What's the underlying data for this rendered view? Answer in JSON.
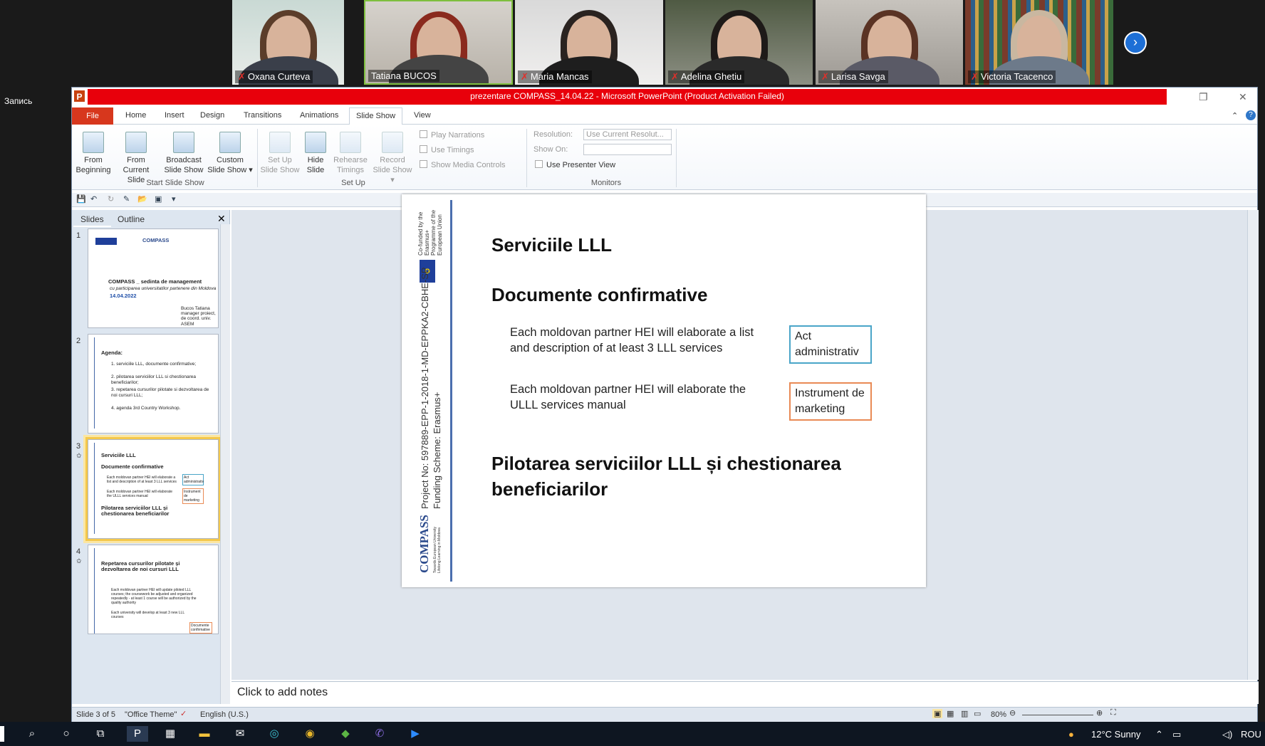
{
  "zoom": {
    "participants": [
      {
        "name": "Oxana Curteva"
      },
      {
        "name": "Tatiana BUCOS"
      },
      {
        "name": "Maria Mancas"
      },
      {
        "name": "Adelina Ghetiu"
      },
      {
        "name": "Larisa Savga"
      },
      {
        "name": "Victoria Tcacenco"
      }
    ],
    "next_icon": "chevron-right-icon",
    "recording_label": "Запись"
  },
  "ppt": {
    "title": "prezentare COMPASS_14.04.22 - Microsoft PowerPoint (Product Activation Failed)",
    "app_icon": "P",
    "tabs": [
      "File",
      "Home",
      "Insert",
      "Design",
      "Transitions",
      "Animations",
      "Slide Show",
      "View"
    ],
    "ribbon": {
      "start": [
        {
          "line1": "From",
          "line2": "Beginning"
        },
        {
          "line1": "From",
          "line2": "Current Slide"
        },
        {
          "line1": "Broadcast",
          "line2": "Slide Show"
        },
        {
          "line1": "Custom",
          "line2": "Slide Show ▾"
        }
      ],
      "start_group": "Start Slide Show",
      "setup": [
        {
          "line1": "Set Up",
          "line2": "Slide Show"
        },
        {
          "line1": "Hide",
          "line2": "Slide"
        },
        {
          "line1": "Rehearse",
          "line2": "Timings"
        },
        {
          "line1": "Record",
          "line2": "Slide Show ▾"
        }
      ],
      "checks": [
        "Play Narrations",
        "Use Timings",
        "Show Media Controls"
      ],
      "setup_group": "Set Up",
      "resolution_label": "Resolution:",
      "resolution_value": "Use Current Resolut...",
      "show_on_label": "Show On:",
      "presenter_view": "Use Presenter View",
      "monitors_group": "Monitors"
    },
    "pane_tabs": [
      "Slides",
      "Outline"
    ],
    "thumbs": [
      {
        "num": "1",
        "title": "COMPASS _ sedinta de management",
        "sub": "cu participarea universitatilor partenere din Moldova",
        "date": "14.04.2022",
        "author": "Bucos Tatiana",
        "author_role": "manager proiect,",
        "author_org": "de coord. univ. ASEM"
      },
      {
        "num": "2",
        "title": "Agenda:",
        "items": [
          "1. serviciile LLL, documente confirmative;",
          "2. pilotarea serviciilor LLL si chestionarea beneficiarilor;",
          "3. repetarea cursurilor pilotate si dezvoltarea de noi cursuri LLL;",
          "4. agenda 3rd Country Workshop."
        ]
      },
      {
        "num": "3",
        "t1": "Serviciile LLL",
        "t2": "Documente confirmative",
        "p1": "Each moldovan partner HEI will elaborate a list and description of at least 3 LLL services",
        "p2": "Each moldovan partner HEI will elaborate the ULLL services manual",
        "b1": "Act administrativ",
        "b2": "Instrument de marketing",
        "t3": "Pilotarea serviciilor LLL și chestionarea beneficiarilor"
      },
      {
        "num": "4",
        "title": "Repetarea cursurilor pilotate și dezvoltarea de noi cursuri LLL",
        "p1": "Each moldovan partner HEI will update piloted LLL courses; the coursework be adjusted and organized repeatedly - at least 1 course will be authorized by the quality authority",
        "p2": "Each university will develop at least 3 new LLL courses",
        "box": "Documente confirmative"
      }
    ],
    "slide": {
      "vert1": "Co-funded by the Erasmus+ Programme of the European Union",
      "vert2": "Project No: 597889-EPP-1-2018-1-MD-EPPKA2-CBHE-SP",
      "vert3": "Funding Scheme: Erasmus+",
      "logo": "COMPASS",
      "logo_sub": "Towards European University Lifelong Learning in Moldova",
      "title1": "Serviciile LLL",
      "title2": "Documente confirmative",
      "para1": "Each moldovan partner HEI will elaborate a list and description of at least 3 LLL services",
      "para2": "Each moldovan partner HEI will elaborate the ULLL services manual",
      "box1": "Act administrativ",
      "box2": "Instrument de marketing",
      "title3": "Pilotarea serviciilor LLL și chestionarea beneficiarilor"
    },
    "notes_placeholder": "Click to add notes",
    "status": {
      "slide": "Slide 3 of 5",
      "theme": "\"Office Theme\"",
      "lang": "English (U.S.)",
      "zoom": "80%"
    }
  },
  "taskbar": {
    "weather": "12°C  Sunny",
    "lang": "ROU"
  },
  "colors": {
    "title_bar_red": "#e8000b",
    "file_tab": "#d7371d",
    "slide_accent": "#4b6fae",
    "box_blue": "#4aa5c8",
    "box_orange": "#e98a55"
  }
}
